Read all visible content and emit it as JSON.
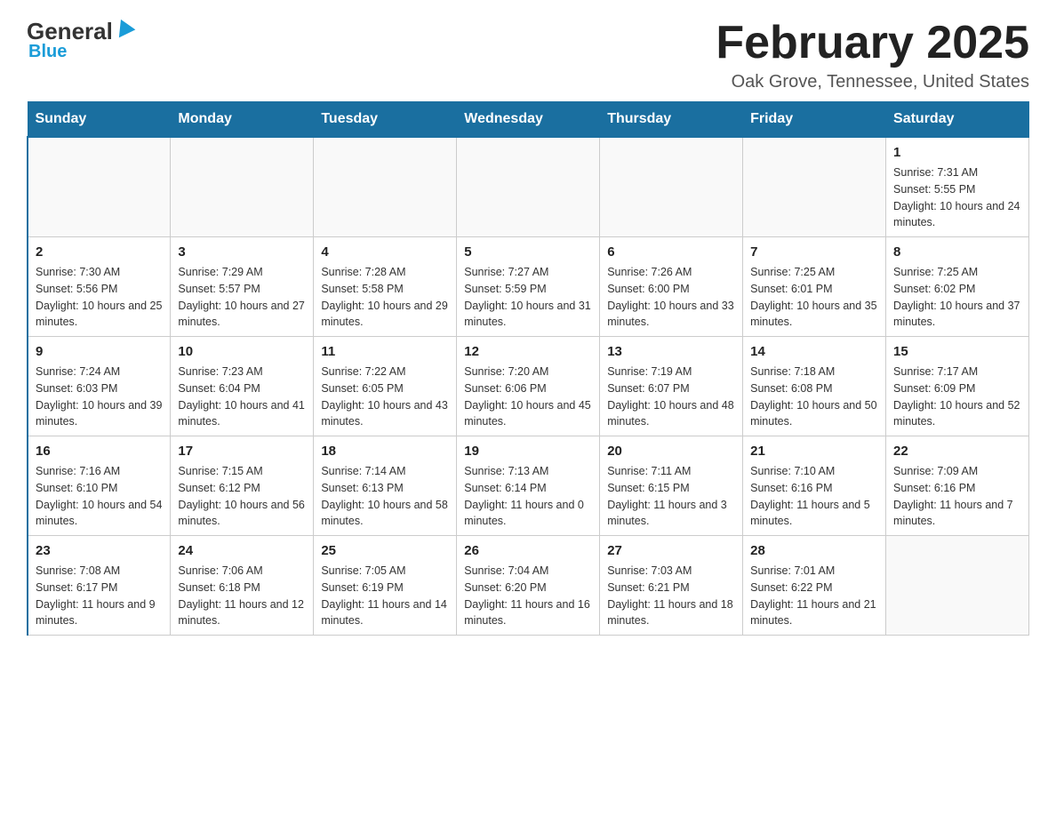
{
  "header": {
    "logo": {
      "text": "General",
      "subtitle": "Blue"
    },
    "title": "February 2025",
    "location": "Oak Grove, Tennessee, United States"
  },
  "days_of_week": [
    "Sunday",
    "Monday",
    "Tuesday",
    "Wednesday",
    "Thursday",
    "Friday",
    "Saturday"
  ],
  "weeks": [
    [
      {
        "day": "",
        "info": ""
      },
      {
        "day": "",
        "info": ""
      },
      {
        "day": "",
        "info": ""
      },
      {
        "day": "",
        "info": ""
      },
      {
        "day": "",
        "info": ""
      },
      {
        "day": "",
        "info": ""
      },
      {
        "day": "1",
        "info": "Sunrise: 7:31 AM\nSunset: 5:55 PM\nDaylight: 10 hours and 24 minutes."
      }
    ],
    [
      {
        "day": "2",
        "info": "Sunrise: 7:30 AM\nSunset: 5:56 PM\nDaylight: 10 hours and 25 minutes."
      },
      {
        "day": "3",
        "info": "Sunrise: 7:29 AM\nSunset: 5:57 PM\nDaylight: 10 hours and 27 minutes."
      },
      {
        "day": "4",
        "info": "Sunrise: 7:28 AM\nSunset: 5:58 PM\nDaylight: 10 hours and 29 minutes."
      },
      {
        "day": "5",
        "info": "Sunrise: 7:27 AM\nSunset: 5:59 PM\nDaylight: 10 hours and 31 minutes."
      },
      {
        "day": "6",
        "info": "Sunrise: 7:26 AM\nSunset: 6:00 PM\nDaylight: 10 hours and 33 minutes."
      },
      {
        "day": "7",
        "info": "Sunrise: 7:25 AM\nSunset: 6:01 PM\nDaylight: 10 hours and 35 minutes."
      },
      {
        "day": "8",
        "info": "Sunrise: 7:25 AM\nSunset: 6:02 PM\nDaylight: 10 hours and 37 minutes."
      }
    ],
    [
      {
        "day": "9",
        "info": "Sunrise: 7:24 AM\nSunset: 6:03 PM\nDaylight: 10 hours and 39 minutes."
      },
      {
        "day": "10",
        "info": "Sunrise: 7:23 AM\nSunset: 6:04 PM\nDaylight: 10 hours and 41 minutes."
      },
      {
        "day": "11",
        "info": "Sunrise: 7:22 AM\nSunset: 6:05 PM\nDaylight: 10 hours and 43 minutes."
      },
      {
        "day": "12",
        "info": "Sunrise: 7:20 AM\nSunset: 6:06 PM\nDaylight: 10 hours and 45 minutes."
      },
      {
        "day": "13",
        "info": "Sunrise: 7:19 AM\nSunset: 6:07 PM\nDaylight: 10 hours and 48 minutes."
      },
      {
        "day": "14",
        "info": "Sunrise: 7:18 AM\nSunset: 6:08 PM\nDaylight: 10 hours and 50 minutes."
      },
      {
        "day": "15",
        "info": "Sunrise: 7:17 AM\nSunset: 6:09 PM\nDaylight: 10 hours and 52 minutes."
      }
    ],
    [
      {
        "day": "16",
        "info": "Sunrise: 7:16 AM\nSunset: 6:10 PM\nDaylight: 10 hours and 54 minutes."
      },
      {
        "day": "17",
        "info": "Sunrise: 7:15 AM\nSunset: 6:12 PM\nDaylight: 10 hours and 56 minutes."
      },
      {
        "day": "18",
        "info": "Sunrise: 7:14 AM\nSunset: 6:13 PM\nDaylight: 10 hours and 58 minutes."
      },
      {
        "day": "19",
        "info": "Sunrise: 7:13 AM\nSunset: 6:14 PM\nDaylight: 11 hours and 0 minutes."
      },
      {
        "day": "20",
        "info": "Sunrise: 7:11 AM\nSunset: 6:15 PM\nDaylight: 11 hours and 3 minutes."
      },
      {
        "day": "21",
        "info": "Sunrise: 7:10 AM\nSunset: 6:16 PM\nDaylight: 11 hours and 5 minutes."
      },
      {
        "day": "22",
        "info": "Sunrise: 7:09 AM\nSunset: 6:16 PM\nDaylight: 11 hours and 7 minutes."
      }
    ],
    [
      {
        "day": "23",
        "info": "Sunrise: 7:08 AM\nSunset: 6:17 PM\nDaylight: 11 hours and 9 minutes."
      },
      {
        "day": "24",
        "info": "Sunrise: 7:06 AM\nSunset: 6:18 PM\nDaylight: 11 hours and 12 minutes."
      },
      {
        "day": "25",
        "info": "Sunrise: 7:05 AM\nSunset: 6:19 PM\nDaylight: 11 hours and 14 minutes."
      },
      {
        "day": "26",
        "info": "Sunrise: 7:04 AM\nSunset: 6:20 PM\nDaylight: 11 hours and 16 minutes."
      },
      {
        "day": "27",
        "info": "Sunrise: 7:03 AM\nSunset: 6:21 PM\nDaylight: 11 hours and 18 minutes."
      },
      {
        "day": "28",
        "info": "Sunrise: 7:01 AM\nSunset: 6:22 PM\nDaylight: 11 hours and 21 minutes."
      },
      {
        "day": "",
        "info": ""
      }
    ]
  ]
}
